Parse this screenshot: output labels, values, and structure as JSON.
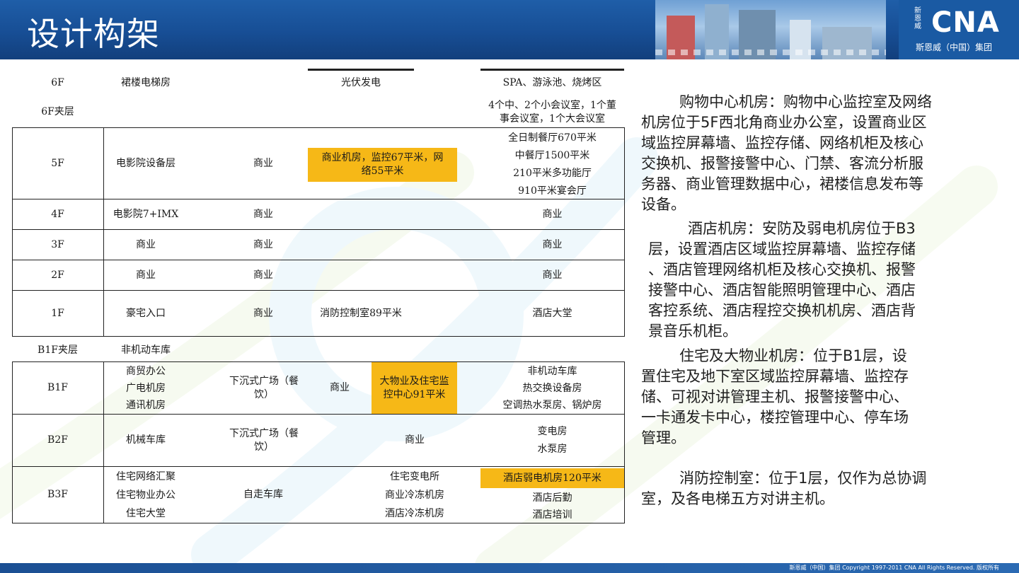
{
  "header": {
    "title": "设计构架",
    "logo_text": "CNA",
    "logo_seal": "新恩威",
    "logo_sub": "斯恩威（中国）集团"
  },
  "table": {
    "f6": {
      "floor": "6F",
      "c1": "裙楼电梯房",
      "c3": "光伏发电",
      "c4": "SPA、游泳池、烧烤区"
    },
    "f6m": {
      "floor": "6F夹层",
      "c4_1": "4个中、2个小会议室，1个董",
      "c4_2": "事会议室，1个大会议室"
    },
    "f5": {
      "floor": "5F",
      "c1": "电影院设备层",
      "c2": "商业",
      "c3_1": "商业机房，监控67平米，网",
      "c3_2": "络55平米",
      "c4": [
        "全日制餐厅670平米",
        "中餐厅1500平米",
        "210平米多功能厅",
        "910平米宴会厅"
      ]
    },
    "f4": {
      "floor": "4F",
      "c1": "电影院7+IMX",
      "c2": "商业",
      "c4": "商业"
    },
    "f3": {
      "floor": "3F",
      "c1": "商业",
      "c2": "商业",
      "c4": "商业"
    },
    "f2": {
      "floor": "2F",
      "c1": "商业",
      "c2": "商业",
      "c4": "商业"
    },
    "f1": {
      "floor": "1F",
      "c1": "豪宅入口",
      "c2": "商业",
      "c3": "消防控制室89平米",
      "c4": "酒店大堂"
    },
    "b1m": {
      "floor": "B1F夹层",
      "c1": "非机动车库"
    },
    "b1": {
      "floor": "B1F",
      "c1": [
        "商贸办公",
        "广电机房",
        "通讯机房"
      ],
      "c2_1": "下沉式广场（餐",
      "c2_2": "饮）",
      "c3a": "商业",
      "c3b_1": "大物业及住宅监",
      "c3b_2": "控中心91平米",
      "c4": [
        "非机动车库",
        "热交换设备房",
        "空调热水泵房、锅炉房"
      ]
    },
    "b2": {
      "floor": "B2F",
      "c1": "机械车库",
      "c2_1": "下沉式广场（餐",
      "c2_2": "饮）",
      "c3": "商业",
      "c4": [
        "变电房",
        "水泵房"
      ]
    },
    "b3": {
      "floor": "B3F",
      "c1": [
        "住宅网络汇聚",
        "住宅物业办公",
        "住宅大堂"
      ],
      "c2": "自走车库",
      "c3": [
        "住宅变电所",
        "商业冷冻机房",
        "酒店冷冻机房"
      ],
      "c4_hl": "酒店弱电机房120平米",
      "c4": [
        "酒店后勤",
        "酒店培训"
      ]
    }
  },
  "paragraphs": {
    "p1": [
      "购物中心机房：购物中心监控室及网络",
      "机房位于5F西北角商业办公室，设置商业区",
      "域监控屏幕墙、监控存储、网络机柜及核心",
      "交换机、报警接警中心、门禁、客流分析服",
      "务器、商业管理数据中心，裙楼信息发布等",
      "设备。"
    ],
    "p2": [
      "酒店机房：安防及弱电机房位于B3",
      "层，设置酒店区域监控屏幕墙、监控存储",
      "、酒店管理网络机柜及核心交换机、报警",
      "接警中心、酒店智能照明管理中心、酒店",
      "客控系统、酒店程控交换机机房、酒店背",
      "景音乐机柜。"
    ],
    "p3": [
      "住宅及大物业机房：位于B1层，设",
      "置住宅及地下室区域监控屏幕墙、监控存",
      "储、可视对讲管理主机、报警接警中心、",
      "一卡通发卡中心，楼控管理中心、停车场",
      "管理。"
    ],
    "p4": [
      "消防控制室：位于1层，仅作为总协调",
      "室，及各电梯五方对讲主机。"
    ]
  },
  "footer": {
    "text": "斯恩威（中国）集团    Copyright 1997-2011 CNA All Rights Reserved. 版权所有"
  },
  "colors": {
    "header_blue": "#174e95",
    "highlight": "#f6b817"
  }
}
